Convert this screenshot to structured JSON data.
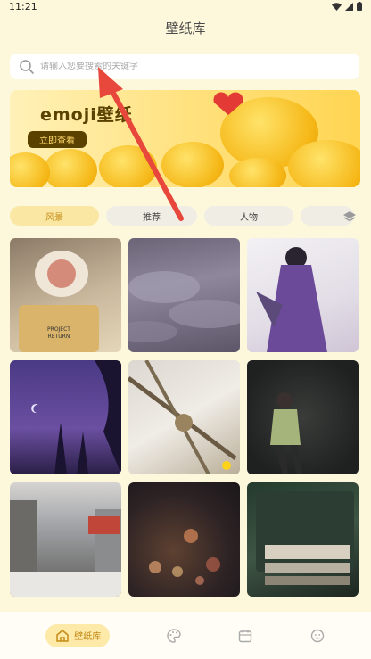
{
  "status_bar": {
    "time": "11:21"
  },
  "header": {
    "title": "壁纸库"
  },
  "search": {
    "placeholder": "请输入您要搜索的关键字"
  },
  "banner": {
    "title": "emoji壁纸",
    "button_label": "立即查看"
  },
  "tabs": [
    {
      "label": "风景",
      "active": true
    },
    {
      "label": "推荐",
      "active": false
    },
    {
      "label": "人物",
      "active": false
    }
  ],
  "bottom_nav": [
    {
      "label": "壁纸库",
      "icon": "home-icon",
      "active": true
    },
    {
      "label": "",
      "icon": "palette-icon",
      "active": false
    },
    {
      "label": "",
      "icon": "calendar-icon",
      "active": false
    },
    {
      "label": "",
      "icon": "smile-icon",
      "active": false
    }
  ],
  "colors": {
    "accent": "#c48c17",
    "accent_bg": "#fbe7a4",
    "page_bg": "#fdf7dc",
    "annotation_arrow": "#e8473c"
  }
}
